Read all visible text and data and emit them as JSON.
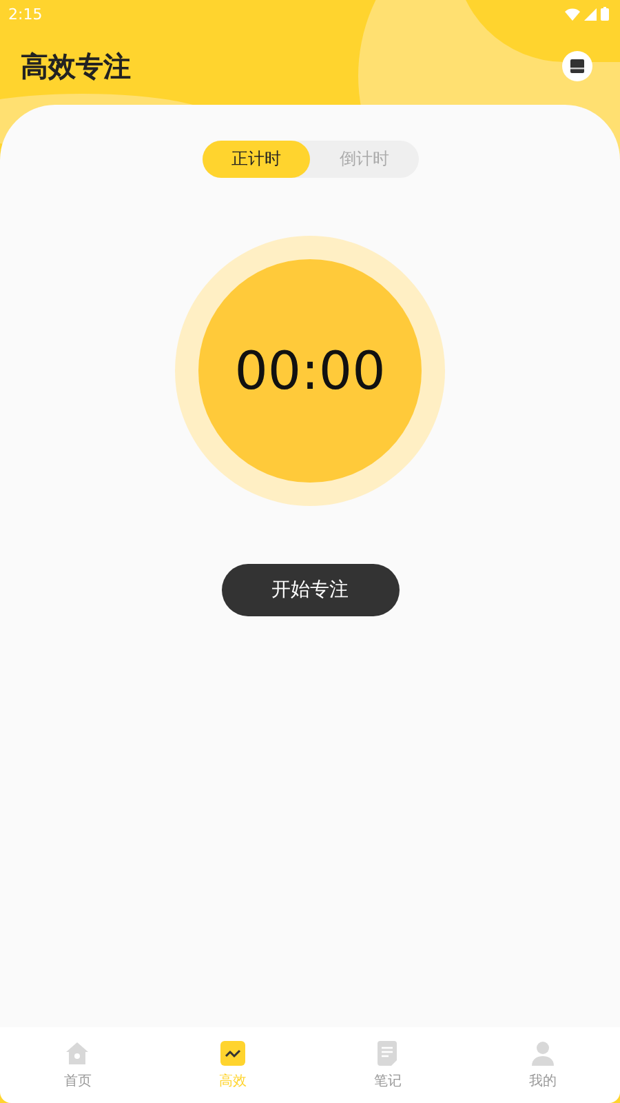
{
  "status_bar": {
    "time": "2:15"
  },
  "header": {
    "title": "高效专注"
  },
  "mode_tabs": [
    {
      "label": "正计时",
      "selected": true
    },
    {
      "label": "倒计时",
      "selected": false
    }
  ],
  "timer": {
    "display": "00:00"
  },
  "start_button": {
    "label": "开始专注"
  },
  "bottom_nav": [
    {
      "label": "首页",
      "selected": false
    },
    {
      "label": "高效",
      "selected": true
    },
    {
      "label": "笔记",
      "selected": false
    },
    {
      "label": "我的",
      "selected": false
    }
  ]
}
